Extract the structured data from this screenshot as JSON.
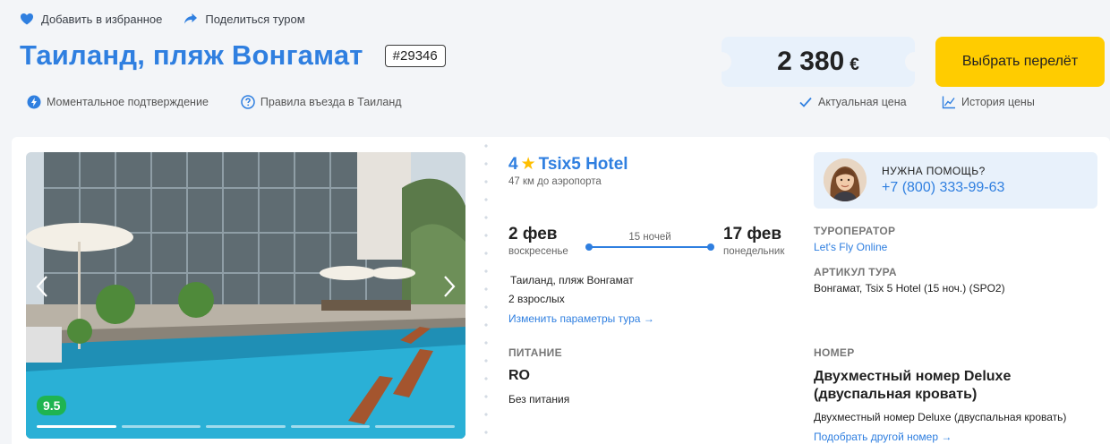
{
  "actions": {
    "favorite": "Добавить в избранное",
    "share": "Поделиться туром"
  },
  "title": "Таиланд, пляж Вонгамат",
  "tour_id": "#29346",
  "info": {
    "instant": "Моментальное подтверждение",
    "rules": "Правила въезда в Таиланд"
  },
  "price": {
    "amount": "2 380",
    "currency": "€",
    "actual": "Актуальная цена",
    "history": "История цены"
  },
  "choose_button": "Выбрать перелёт",
  "photo": {
    "score": "9.5",
    "slides_total": 5,
    "slide_active": 1
  },
  "hotel": {
    "stars": "4",
    "name": "Tsix5 Hotel",
    "airport": "47 км до аэропорта"
  },
  "dates": {
    "from": "2 фев",
    "from_day": "воскресенье",
    "to": "17 фев",
    "to_day": "понедельник",
    "nights": "15 ночей"
  },
  "location": "Таиланд, пляж Вонгамат",
  "pax": "2 взрослых",
  "change_params": "Изменить параметры тура",
  "food": {
    "label": "ПИТАНИЕ",
    "code": "RO",
    "desc": "Без питания"
  },
  "help": {
    "title": "НУЖНА ПОМОЩЬ?",
    "phone": "+7 (800) 333-99-63"
  },
  "operator": {
    "label": "ТУРОПЕРАТОР",
    "value": "Let's Fly Online"
  },
  "article": {
    "label": "АРТИКУЛ ТУРА",
    "value": "Вонгамат, Tsix 5 Hotel (15 ноч.) (SPO2)"
  },
  "room": {
    "label": "НОМЕР",
    "name": "Двухместный номер Deluxe (двуспальная кровать)",
    "desc": "Двухместный номер Deluxe (двуспальная кровать)",
    "change": "Подобрать другой номер"
  },
  "colors": {
    "brand_blue": "#2f7fe0",
    "button_yellow": "#ffcc00",
    "score_green": "#1fb451",
    "star_gold": "#ffbf00",
    "panel_blue": "#e8f1fb"
  }
}
